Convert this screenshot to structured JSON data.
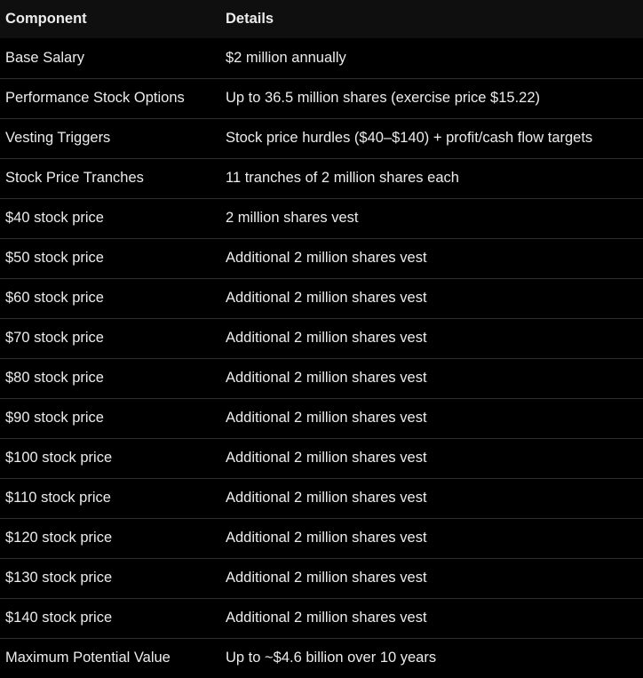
{
  "table": {
    "headers": [
      "Component",
      "Details"
    ],
    "rows": [
      [
        "Base Salary",
        "$2 million annually"
      ],
      [
        "Performance Stock Options",
        "Up to 36.5 million shares (exercise price $15.22)"
      ],
      [
        "Vesting Triggers",
        "Stock price hurdles ($40–$140) + profit/cash flow targets"
      ],
      [
        "Stock Price Tranches",
        "11 tranches of 2 million shares each"
      ],
      [
        "$40 stock price",
        "2 million shares vest"
      ],
      [
        "$50 stock price",
        "Additional 2 million shares vest"
      ],
      [
        "$60 stock price",
        "Additional 2 million shares vest"
      ],
      [
        "$70 stock price",
        "Additional 2 million shares vest"
      ],
      [
        "$80 stock price",
        "Additional 2 million shares vest"
      ],
      [
        "$90 stock price",
        "Additional 2 million shares vest"
      ],
      [
        "$100 stock price",
        "Additional 2 million shares vest"
      ],
      [
        "$110 stock price",
        "Additional 2 million shares vest"
      ],
      [
        "$120 stock price",
        "Additional 2 million shares vest"
      ],
      [
        "$130 stock price",
        "Additional 2 million shares vest"
      ],
      [
        "$140 stock price",
        "Additional 2 million shares vest"
      ],
      [
        "Maximum Potential Value",
        "Up to ~$4.6 billion over 10 years"
      ]
    ]
  }
}
